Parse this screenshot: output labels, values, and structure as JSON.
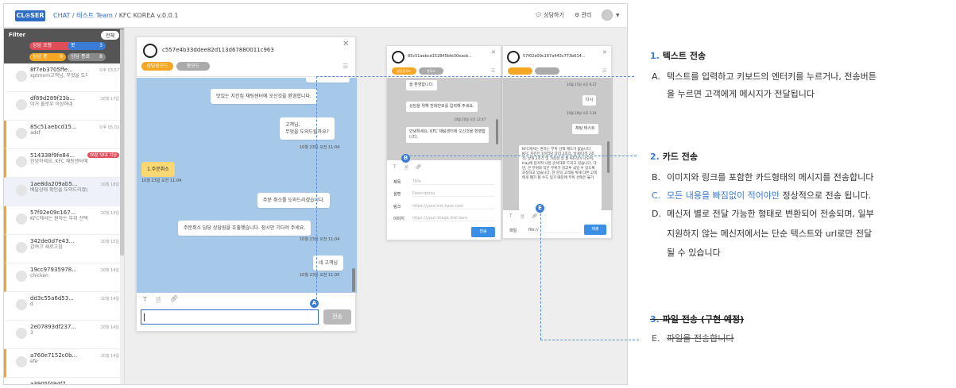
{
  "topbar": {
    "logo": "CL⊙SER",
    "crumb_chat": "CHAT",
    "crumb_team": " / 테스트 Team / ",
    "crumb_app": "KFC KOREA v.0.0.1",
    "consult": "상담하기",
    "manage": "관리"
  },
  "filter": {
    "title": "Filter",
    "all": "전체",
    "pills": [
      {
        "label": "상담 요청",
        "count": "1",
        "color": "#e04e5a"
      },
      {
        "label": "봇",
        "count": "3",
        "color": "#3a7bd5"
      },
      {
        "label": "상담 중",
        "count": "6",
        "color": "#f5a623"
      },
      {
        "label": "상담 종료",
        "count": "8",
        "color": "#7a7a7a"
      }
    ]
  },
  "conversations": [
    {
      "name": "8f7eb3705ffe...",
      "preview": "xptmxm고객님, 무엇을 도와드릴까요?",
      "time": "오후 03:57"
    },
    {
      "name": "df89d289f23b...",
      "preview": "이거 물로우 이상하네",
      "time": "10월 17일"
    },
    {
      "name": "85c51aebcd15...",
      "preview": "adsf",
      "time": "오후 05:02"
    },
    {
      "name": "514338f9fe84...",
      "preview": "안녕하세요, KFC 채팅센터에 오신것을 환...",
      "time": "",
      "badge": "06분 58초 지남"
    },
    {
      "name": "1ae8da209ab5...",
      "preview": "배달상태 확인을 도와드리겠습니다",
      "time": "10월 18일"
    },
    {
      "name": "57f02e09c167...",
      "preview": "KFC에서는 원하는 부위 선택 제도가 없습...",
      "time": "10월 19일"
    },
    {
      "name": "342de0d7e43...",
      "preview": "감여크 새로고침",
      "time": "10월 15일"
    },
    {
      "name": "19cc97935978...",
      "preview": "chicken",
      "time": "10월 14일"
    },
    {
      "name": "dd3c55a6d53...",
      "preview": "d",
      "time": "10월 14일"
    },
    {
      "name": "2e07893df237...",
      "preview": "3",
      "time": "10월 14일"
    },
    {
      "name": "a760e7152c0b...",
      "preview": "efe",
      "time": "10월 14일"
    },
    {
      "name": "a3905f494f7...",
      "preview": "",
      "time": ""
    }
  ],
  "main_chat": {
    "id": "c557e4b33ddee82d113d67880011c963",
    "mode_consult": "상담원모드",
    "mode_bot": "봇모드",
    "messages": [
      {
        "text": "맛있는 치킨집 채팅센터에 오신것을 환영합니다."
      },
      {
        "text": "고객님,\n무엇을 도와드릴까요?",
        "ts": "10월 23일 오전 11:04"
      },
      {
        "text": "1.주문취소",
        "ts": "10월 23일 오전 11:04"
      },
      {
        "text": "주문 취소를 도와드리겠습니다."
      },
      {
        "text": "주문취소 담당 상담원을 호출했습니다. 잠시만 기다려 주세요.",
        "ts": "10월 23일 오전 11:04"
      },
      {
        "text": "네 고객님",
        "ts": "10월 23일 오전 11:05"
      }
    ],
    "send": "전송"
  },
  "card_panel": {
    "id": "85c51aebcd152845bfe30eacb...",
    "mode_consult": "상담원모드",
    "mode_bot": "봇모드",
    "msg1": "을 환영합니다.",
    "msg2": "상담을 위해 전화번호를 입력해 주세요.",
    "ts2": "10월 20일 오후 12:47",
    "msg3": "안녕하세요, KFC 채팅센터에 오신것을 환영합니다.",
    "fields": [
      {
        "label": "제목",
        "placeholder": "Title"
      },
      {
        "label": "설명",
        "placeholder": "Description"
      },
      {
        "label": "링크",
        "placeholder": "https://your.link.here.com"
      },
      {
        "label": "이미지",
        "placeholder": "https://your.image.link.here"
      }
    ],
    "send": "전송"
  },
  "file_panel": {
    "id": "57f02e09c167a443c773b614...",
    "ts1": "10월 15일 오후 6:27",
    "msg1": "다시",
    "ts2": "10월 18일 오후 2:24",
    "msg2": "채팅 테스트",
    "msg3": "KFC에서는 원하는 부위 선택 제도가 없습니다. KFC 치킨은 1마리당 다리 2조각, 날개/다리 2조각, 날개 2조각 및 가슴살 등 총 9조각이 나오며, tray에 담겨져 나온 순서대로 드리고 있습니다. 다만, 큰 부위와 작은 부위가 골고루 섞일 수 있도록 조정하고 있습니다. 한 분의 고객을 위해 다른 고객에게 폐가 될 수도 있기 때문에 부위 선택은 불가",
    "file_label": "파일",
    "file_value": "file://",
    "send": "제출"
  },
  "markers": {
    "a": "A",
    "b": "B",
    "e": "E"
  },
  "annotations": {
    "s1": {
      "num": "1.",
      "title": "텍스트 전송",
      "items": [
        {
          "letter": "A.",
          "text": "텍스트를 입력하고 키보드의 엔터키를 누르거나, 전송버튼"
        },
        {
          "letter": "",
          "text": "을 누르면 고객에게 메시지가 전달됩니다"
        }
      ]
    },
    "s2": {
      "num": "2.",
      "title": "카드 전송",
      "items": [
        {
          "letter": "B.",
          "text": "이미지와 링크를 포함한 카드형태의 메시지를 전송합니다"
        },
        {
          "letter": "C.",
          "text": "모든 내용을 빠짐없이 적어야만",
          "tail": " 정상적으로 전송 됩니다."
        },
        {
          "letter": "D.",
          "text": "메신저 별로 전달 가능한 형태로 변환되어 전송되며, 일부"
        },
        {
          "letter": "",
          "text": "지원하지 않는 메신저에서는 단순 텍스트와 url로만 전달"
        },
        {
          "letter": "",
          "text": "될 수 있습니다"
        }
      ]
    },
    "s3": {
      "num": "3.",
      "title": "파일 전송 (구현 예정)",
      "items": [
        {
          "letter": "E.",
          "text": "파일을 전송합니다"
        }
      ]
    }
  }
}
